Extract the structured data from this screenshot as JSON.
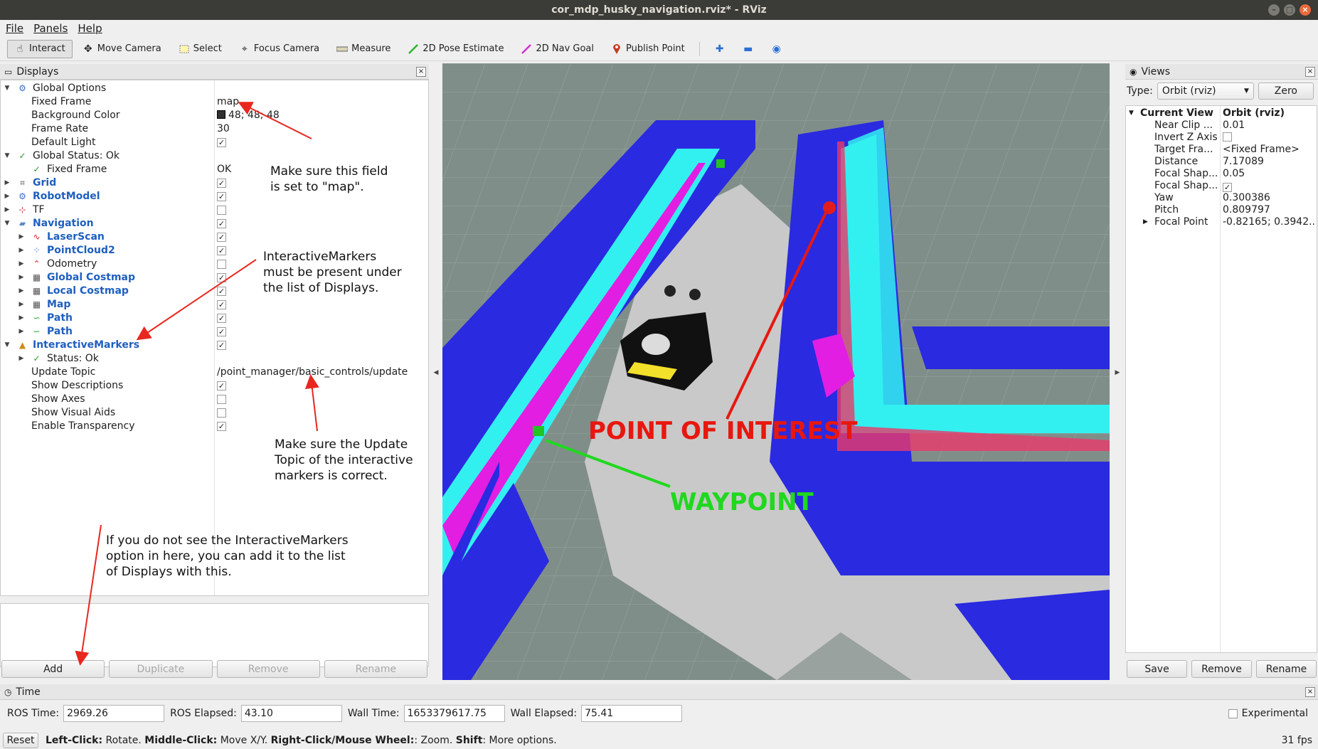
{
  "window": {
    "title": "cor_mdp_husky_navigation.rviz* - RViz"
  },
  "menu": {
    "file": "File",
    "panels": "Panels",
    "help": "Help"
  },
  "toolbar": {
    "interact": "Interact",
    "move_camera": "Move Camera",
    "select": "Select",
    "focus_camera": "Focus Camera",
    "measure": "Measure",
    "pose_estimate": "2D Pose Estimate",
    "nav_goal": "2D Nav Goal",
    "publish_point": "Publish Point"
  },
  "displays": {
    "title": "Displays",
    "rows": [
      {
        "name": "Global Options"
      },
      {
        "name": "Fixed Frame",
        "value": "map"
      },
      {
        "name": "Background Color",
        "value": "48; 48; 48"
      },
      {
        "name": "Frame Rate",
        "value": "30"
      },
      {
        "name": "Default Light",
        "checked": true
      },
      {
        "name": "Global Status: Ok"
      },
      {
        "name": "Fixed Frame",
        "value": "OK"
      },
      {
        "name": "Grid",
        "checked": true
      },
      {
        "name": "RobotModel",
        "checked": true
      },
      {
        "name": "TF",
        "checked": false
      },
      {
        "name": "Navigation",
        "checked": true
      },
      {
        "name": "LaserScan",
        "checked": true
      },
      {
        "name": "PointCloud2",
        "checked": true
      },
      {
        "name": "Odometry",
        "checked": false
      },
      {
        "name": "Global Costmap",
        "checked": true
      },
      {
        "name": "Local Costmap",
        "checked": true
      },
      {
        "name": "Map",
        "checked": true
      },
      {
        "name": "Path",
        "checked": true
      },
      {
        "name": "Path",
        "checked": true
      },
      {
        "name": "InteractiveMarkers",
        "checked": true
      },
      {
        "name": "Status: Ok"
      },
      {
        "name": "Update Topic",
        "value": "/point_manager/basic_controls/update"
      },
      {
        "name": "Show Descriptions",
        "checked": true
      },
      {
        "name": "Show Axes",
        "checked": false
      },
      {
        "name": "Show Visual Aids",
        "checked": false
      },
      {
        "name": "Enable Transparency",
        "checked": true
      }
    ],
    "buttons": {
      "add": "Add",
      "duplicate": "Duplicate",
      "remove": "Remove",
      "rename": "Rename"
    }
  },
  "annotations": {
    "fixed_frame_note": [
      "Make sure this field",
      "is set to \"map\"."
    ],
    "markers_note": [
      "InteractiveMarkers",
      "must be present under",
      "the list of Displays."
    ],
    "topic_note": [
      "Make sure the Update",
      "Topic of the interactive",
      "markers is correct."
    ],
    "add_note": [
      "If you do not see the InteractiveMarkers",
      "option in here, you can add it to the list",
      "of Displays with this."
    ],
    "point_of_interest": "POINT OF INTEREST",
    "waypoint": "WAYPOINT"
  },
  "views": {
    "title": "Views",
    "type_label": "Type:",
    "type_value": "Orbit (rviz)",
    "zero": "Zero",
    "current_view": {
      "name": "Current View",
      "value": "Orbit (rviz)"
    },
    "props": [
      {
        "name": "Near Clip ...",
        "value": "0.01"
      },
      {
        "name": "Invert Z Axis",
        "value": ""
      },
      {
        "name": "Target Fra...",
        "value": "<Fixed Frame>"
      },
      {
        "name": "Distance",
        "value": "7.17089"
      },
      {
        "name": "Focal Shap...",
        "value": "0.05"
      },
      {
        "name": "Focal Shap...",
        "value": ""
      },
      {
        "name": "Yaw",
        "value": "0.300386"
      },
      {
        "name": "Pitch",
        "value": "0.809797"
      },
      {
        "name": "Focal Point",
        "value": "-0.82165; 0.3942..."
      }
    ],
    "buttons": {
      "save": "Save",
      "remove": "Remove",
      "rename": "Rename"
    }
  },
  "time": {
    "title": "Time",
    "ros_time_label": "ROS Time:",
    "ros_time": "2969.26",
    "ros_elapsed_label": "ROS Elapsed:",
    "ros_elapsed": "43.10",
    "wall_time_label": "Wall Time:",
    "wall_time": "1653379617.75",
    "wall_elapsed_label": "Wall Elapsed:",
    "wall_elapsed": "75.41",
    "experimental": "Experimental"
  },
  "status": {
    "reset": "Reset",
    "left_click": "Left-Click:",
    "left_click_desc": " Rotate. ",
    "middle_click": "Middle-Click:",
    "middle_click_desc": " Move X/Y. ",
    "right_click": "Right-Click/Mouse Wheel:",
    "right_click_desc": ": Zoom. ",
    "shift": "Shift",
    "shift_desc": ": More options.",
    "fps": "31 fps"
  },
  "colors": {
    "annotation_arrow": "#e8271f",
    "poi_text": "#e8170f",
    "waypoint_text": "#20d81e"
  }
}
